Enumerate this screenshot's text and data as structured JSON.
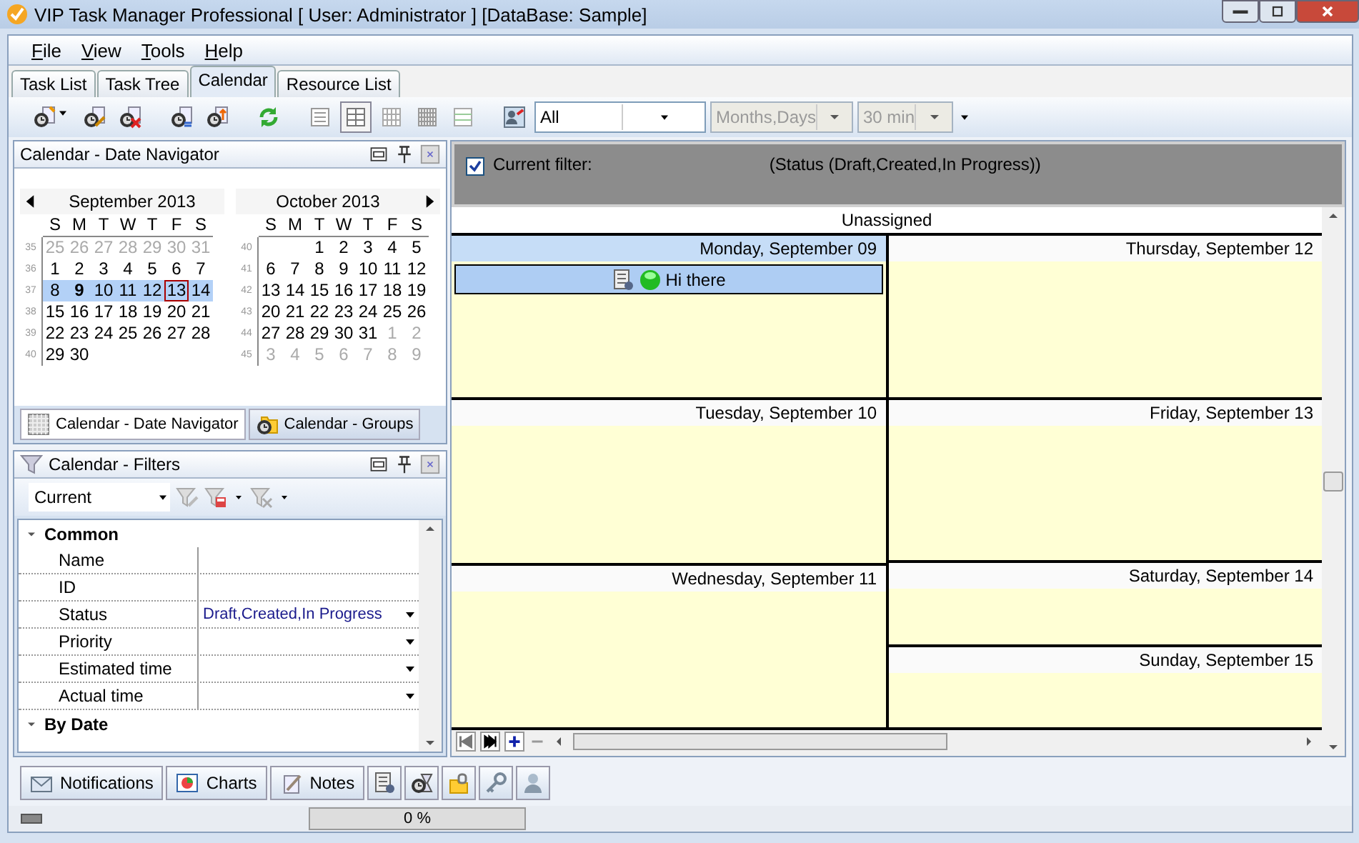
{
  "window": {
    "title": "VIP Task Manager Professional [ User: Administrator ] [DataBase: Sample]"
  },
  "menu": [
    "File",
    "View",
    "Tools",
    "Help"
  ],
  "tabs": [
    {
      "label": "Task List",
      "selected": false
    },
    {
      "label": "Task Tree",
      "selected": false
    },
    {
      "label": "Calendar",
      "selected": true
    },
    {
      "label": "Resource List",
      "selected": false
    }
  ],
  "toolbar": {
    "dropdowns": [
      {
        "value": "All",
        "disabled": false
      },
      {
        "value": "Months,Days",
        "disabled": true
      },
      {
        "value": "30 min",
        "disabled": true
      }
    ]
  },
  "date_navigator": {
    "title": "Calendar - Date Navigator",
    "months": [
      {
        "title": "September 2013",
        "weekdays": [
          "S",
          "M",
          "T",
          "W",
          "T",
          "F",
          "S"
        ],
        "weeks": [
          {
            "number": "35",
            "selected": false,
            "days": [
              {
                "label": "25",
                "kind": "other"
              },
              {
                "label": "26",
                "kind": "other"
              },
              {
                "label": "27",
                "kind": "other"
              },
              {
                "label": "28",
                "kind": "other"
              },
              {
                "label": "29",
                "kind": "other"
              },
              {
                "label": "30",
                "kind": "other"
              },
              {
                "label": "31",
                "kind": "other"
              }
            ]
          },
          {
            "number": "36",
            "selected": false,
            "days": [
              {
                "label": "1",
                "kind": "normal"
              },
              {
                "label": "2",
                "kind": "normal"
              },
              {
                "label": "3",
                "kind": "normal"
              },
              {
                "label": "4",
                "kind": "normal"
              },
              {
                "label": "5",
                "kind": "normal"
              },
              {
                "label": "6",
                "kind": "normal"
              },
              {
                "label": "7",
                "kind": "normal"
              }
            ]
          },
          {
            "number": "37",
            "selected": true,
            "days": [
              {
                "label": "8",
                "kind": "normal"
              },
              {
                "label": "9",
                "kind": "bold"
              },
              {
                "label": "10",
                "kind": "normal"
              },
              {
                "label": "11",
                "kind": "normal"
              },
              {
                "label": "12",
                "kind": "normal"
              },
              {
                "label": "13",
                "kind": "today"
              },
              {
                "label": "14",
                "kind": "normal"
              }
            ]
          },
          {
            "number": "38",
            "selected": false,
            "days": [
              {
                "label": "15",
                "kind": "normal"
              },
              {
                "label": "16",
                "kind": "normal"
              },
              {
                "label": "17",
                "kind": "normal"
              },
              {
                "label": "18",
                "kind": "normal"
              },
              {
                "label": "19",
                "kind": "normal"
              },
              {
                "label": "20",
                "kind": "normal"
              },
              {
                "label": "21",
                "kind": "normal"
              }
            ]
          },
          {
            "number": "39",
            "selected": false,
            "days": [
              {
                "label": "22",
                "kind": "normal"
              },
              {
                "label": "23",
                "kind": "normal"
              },
              {
                "label": "24",
                "kind": "normal"
              },
              {
                "label": "25",
                "kind": "normal"
              },
              {
                "label": "26",
                "kind": "normal"
              },
              {
                "label": "27",
                "kind": "normal"
              },
              {
                "label": "28",
                "kind": "normal"
              }
            ]
          },
          {
            "number": "40",
            "selected": false,
            "days": [
              {
                "label": "29",
                "kind": "normal"
              },
              {
                "label": "30",
                "kind": "normal"
              }
            ]
          }
        ]
      },
      {
        "title": "October 2013",
        "weekdays": [
          "S",
          "M",
          "T",
          "W",
          "T",
          "F",
          "S"
        ],
        "weeks": [
          {
            "number": "40",
            "selected": false,
            "days": [
              {
                "kind": "blank"
              },
              {
                "kind": "blank"
              },
              {
                "label": "1",
                "kind": "normal"
              },
              {
                "label": "2",
                "kind": "normal"
              },
              {
                "label": "3",
                "kind": "normal"
              },
              {
                "label": "4",
                "kind": "normal"
              },
              {
                "label": "5",
                "kind": "normal"
              }
            ]
          },
          {
            "number": "41",
            "selected": false,
            "days": [
              {
                "label": "6",
                "kind": "normal"
              },
              {
                "label": "7",
                "kind": "normal"
              },
              {
                "label": "8",
                "kind": "normal"
              },
              {
                "label": "9",
                "kind": "normal"
              },
              {
                "label": "10",
                "kind": "normal"
              },
              {
                "label": "11",
                "kind": "normal"
              },
              {
                "label": "12",
                "kind": "normal"
              }
            ]
          },
          {
            "number": "42",
            "selected": false,
            "days": [
              {
                "label": "13",
                "kind": "normal"
              },
              {
                "label": "14",
                "kind": "normal"
              },
              {
                "label": "15",
                "kind": "normal"
              },
              {
                "label": "16",
                "kind": "normal"
              },
              {
                "label": "17",
                "kind": "normal"
              },
              {
                "label": "18",
                "kind": "normal"
              },
              {
                "label": "19",
                "kind": "normal"
              }
            ]
          },
          {
            "number": "43",
            "selected": false,
            "days": [
              {
                "label": "20",
                "kind": "normal"
              },
              {
                "label": "21",
                "kind": "normal"
              },
              {
                "label": "22",
                "kind": "normal"
              },
              {
                "label": "23",
                "kind": "normal"
              },
              {
                "label": "24",
                "kind": "normal"
              },
              {
                "label": "25",
                "kind": "normal"
              },
              {
                "label": "26",
                "kind": "normal"
              }
            ]
          },
          {
            "number": "44",
            "selected": false,
            "days": [
              {
                "label": "27",
                "kind": "normal"
              },
              {
                "label": "28",
                "kind": "normal"
              },
              {
                "label": "29",
                "kind": "normal"
              },
              {
                "label": "30",
                "kind": "normal"
              },
              {
                "label": "31",
                "kind": "normal"
              },
              {
                "label": "1",
                "kind": "other"
              },
              {
                "label": "2",
                "kind": "other"
              }
            ]
          },
          {
            "number": "45",
            "selected": false,
            "days": [
              {
                "label": "3",
                "kind": "other"
              },
              {
                "label": "4",
                "kind": "other"
              },
              {
                "label": "5",
                "kind": "other"
              },
              {
                "label": "6",
                "kind": "other"
              },
              {
                "label": "7",
                "kind": "other"
              },
              {
                "label": "8",
                "kind": "other"
              },
              {
                "label": "9",
                "kind": "other"
              }
            ]
          }
        ]
      }
    ],
    "tabs": [
      {
        "label": "Calendar - Date Navigator",
        "selected": true
      },
      {
        "label": "Calendar - Groups",
        "selected": false
      }
    ]
  },
  "filters": {
    "title": "Calendar - Filters",
    "preset": "Current",
    "rows": [
      {
        "kind": "group",
        "label": "Common"
      },
      {
        "kind": "property",
        "label": "Name",
        "dropdown": false
      },
      {
        "kind": "property",
        "label": "ID",
        "dropdown": false
      },
      {
        "kind": "property",
        "label": "Status",
        "value": "Draft,Created,In Progress",
        "dropdown": true
      },
      {
        "kind": "property",
        "label": "Priority",
        "dropdown": true
      },
      {
        "kind": "property",
        "label": "Estimated time",
        "dropdown": true
      },
      {
        "kind": "property",
        "label": "Actual time",
        "dropdown": true
      },
      {
        "kind": "group",
        "label": "By Date"
      }
    ]
  },
  "filter_bar": {
    "checked": true,
    "label": "Current filter:",
    "expression": "(Status  (Draft,Created,In Progress))"
  },
  "calendar": {
    "resource": "Unassigned",
    "columns": [
      {
        "days": [
          {
            "title": "Monday, September 09",
            "kind": "weekday",
            "selected": true,
            "tasks": [
              "Hi there"
            ]
          },
          {
            "title": "Tuesday, September 10",
            "kind": "weekday",
            "selected": false
          },
          {
            "title": "Wednesday, September 11",
            "kind": "weekday",
            "selected": false
          }
        ]
      },
      {
        "days": [
          {
            "title": "Thursday, September 12",
            "kind": "weekday",
            "selected": false
          },
          {
            "title": "Friday, September 13",
            "kind": "weekday",
            "selected": false
          },
          {
            "title": "Saturday, September 14",
            "kind": "weekend",
            "selected": false
          },
          {
            "title": "Sunday, September 15",
            "kind": "weekend",
            "selected": false
          }
        ]
      }
    ]
  },
  "bottom_tabs": [
    "Notifications",
    "Charts",
    "Notes"
  ],
  "status_bar": {
    "progress": {
      "text": "0 %",
      "level": 0
    }
  }
}
